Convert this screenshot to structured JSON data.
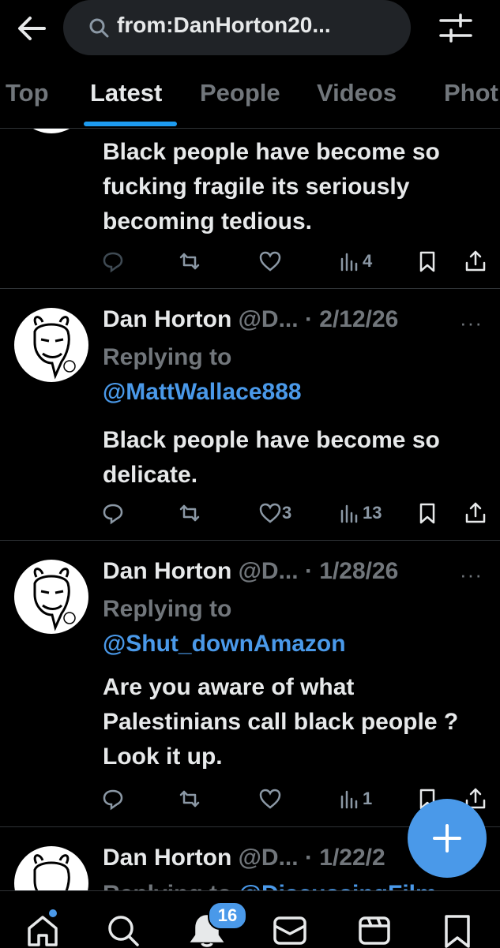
{
  "search": {
    "query": "from:DanHorton20..."
  },
  "tabs": [
    "Top",
    "Latest",
    "People",
    "Videos",
    "Phot"
  ],
  "active_tab": "Latest",
  "tweets": [
    {
      "body": "Black people have become so fucking fragile its seriously becoming tedious.",
      "replies": "",
      "retweets": "",
      "likes": "",
      "views": "4"
    },
    {
      "name": "Dan Horton",
      "handle": "@D...",
      "date": "· 2/12/26",
      "replying_prefix": "Replying to",
      "replying_to": "@MattWallace888",
      "body": "Black people have become so delicate.",
      "replies": "",
      "retweets": "",
      "likes": "3",
      "views": "13"
    },
    {
      "name": "Dan Horton",
      "handle": "@D...",
      "date": "· 1/28/26",
      "replying_prefix": "Replying to",
      "replying_to": "@Shut_downAmazon",
      "body": "Are you aware of what Palestinians call black people ? Look it up.",
      "replies": "",
      "retweets": "",
      "likes": "",
      "views": "1"
    },
    {
      "name": "Dan Horton",
      "handle": "@D...",
      "date": "· 1/22/2",
      "replying_prefix": "Replying to",
      "replying_to": "@DiscussingFilm"
    }
  ],
  "more_label": "···",
  "notification_badge": "16",
  "icons": {
    "back": "arrow-left-icon",
    "search": "search-icon",
    "filter": "sliders-icon",
    "reply": "reply-icon",
    "retweet": "retweet-icon",
    "like": "heart-icon",
    "views": "views-icon",
    "bookmark": "bookmark-icon",
    "share": "share-icon",
    "compose": "plus-icon",
    "nav": [
      "home-icon",
      "explore-icon",
      "notifications-icon",
      "messages-icon",
      "communities-icon",
      "bookmarks-icon"
    ]
  },
  "colors": {
    "background": "#000000",
    "accent": "#4a99e9",
    "text": "#e7e9ea",
    "muted": "#71767b",
    "divider": "#2f3336"
  }
}
